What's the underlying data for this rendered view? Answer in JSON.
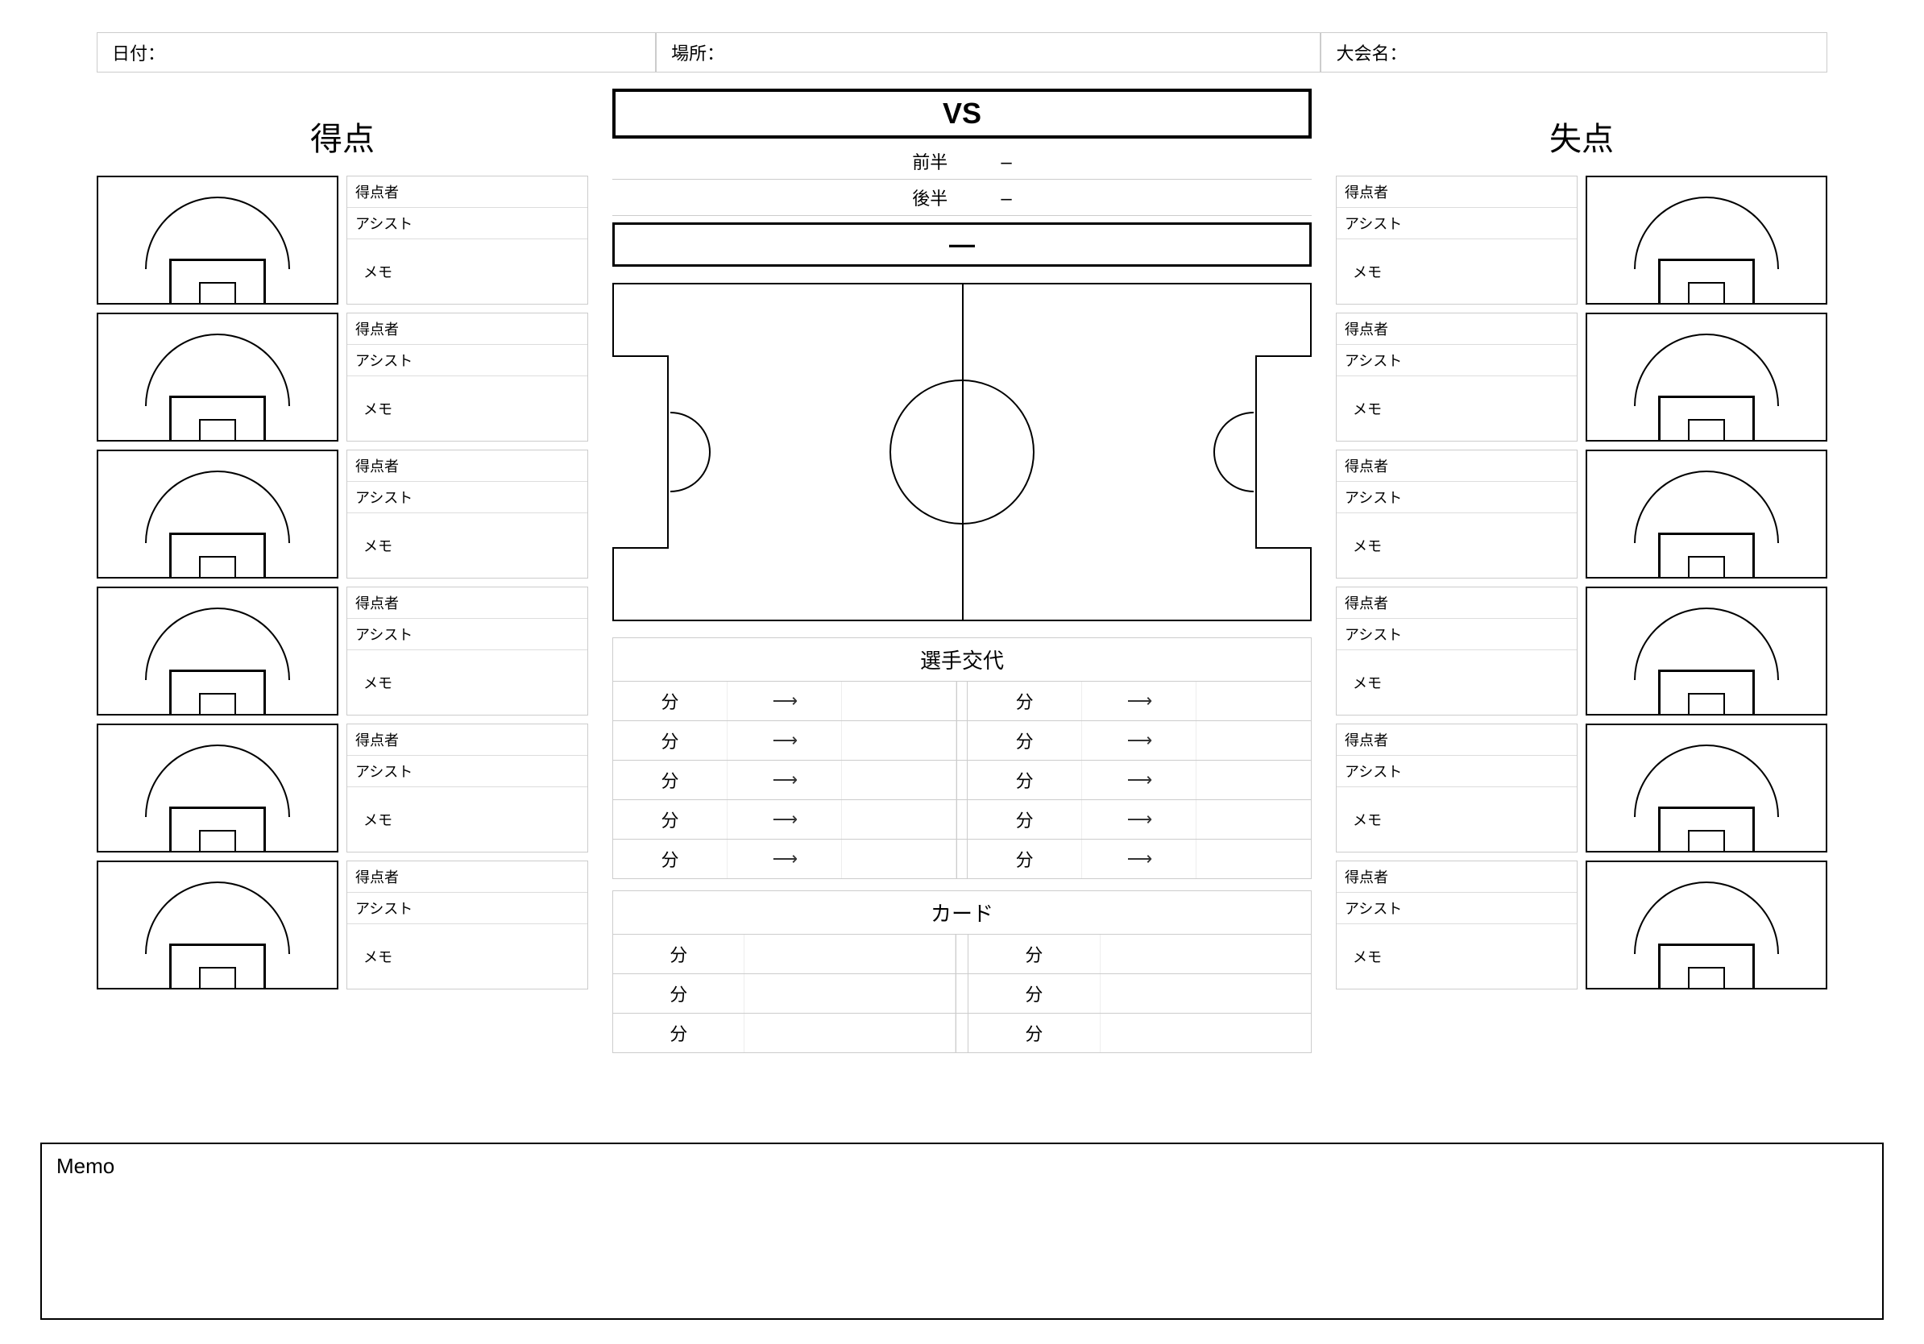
{
  "header": {
    "date_label": "日付：",
    "place_label": "場所：",
    "tournament_label": "大会名："
  },
  "columns": {
    "goals_for_title": "得点",
    "goals_against_title": "失点"
  },
  "center": {
    "vs_label": "VS",
    "first_half_label": "前半",
    "second_half_label": "後半",
    "dash": "–",
    "total_dash": "—",
    "subs_title": "選手交代",
    "cards_title": "カード",
    "minute_label": "分",
    "arrow_symbol": "⟶",
    "sub_rows": 5,
    "card_rows": 3
  },
  "goal_meta": {
    "scorer_label": "得点者",
    "assist_label": "アシスト",
    "memo_label": "メモ"
  },
  "memo": {
    "title": "Memo"
  },
  "goal_count_per_side": 6
}
